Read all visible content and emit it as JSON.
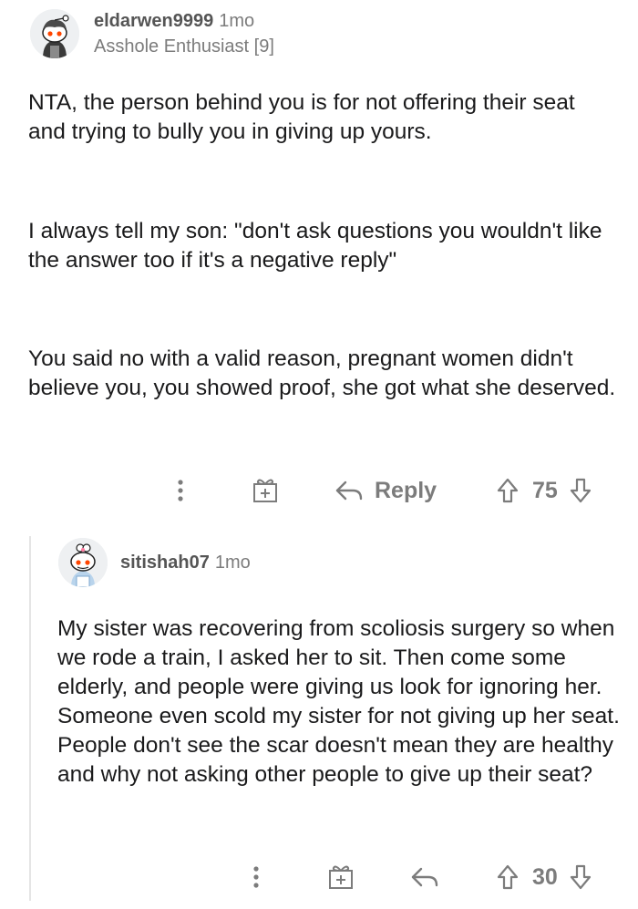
{
  "comments": [
    {
      "username": "eldarwen9999",
      "time": "1mo",
      "flair": "Asshole Enthusiast [9]",
      "paragraphs": [
        "NTA, the person behind you is for not offering their seat and trying to bully you in giving up yours.",
        "I always tell my son: \"don't ask questions you wouldn't like the answer too if it's a negative reply\"",
        "You said no with a valid reason, pregnant women didn't believe you, you showed proof, she got what she deserved."
      ],
      "actions": {
        "more_icon": "vertical-ellipsis-icon",
        "award_icon": "gift-plus-icon",
        "reply_icon": "reply-arrow-icon",
        "reply_label": "Reply",
        "upvote_icon": "upvote-arrow-icon",
        "score": "75",
        "downvote_icon": "downvote-arrow-icon"
      }
    },
    {
      "username": "sitishah07",
      "time": "1mo",
      "paragraphs": [
        "My sister was recovering from scoliosis surgery so when we rode a train, I asked her to sit. Then come some elderly, and people were giving us look for ignoring her. Someone even scold my sister for not giving up her seat. People don't see the scar doesn't mean they are healthy and why not asking other people to give up their seat?"
      ],
      "actions": {
        "more_icon": "vertical-ellipsis-icon",
        "award_icon": "gift-plus-icon",
        "reply_icon": "reply-arrow-icon",
        "upvote_icon": "upvote-arrow-icon",
        "score": "30",
        "downvote_icon": "downvote-arrow-icon"
      }
    }
  ],
  "colors": {
    "text": "#1a1a1b",
    "meta": "#7c7c7c",
    "thread_line": "#e5e5e5",
    "avatar_orange": "#ff4500"
  }
}
